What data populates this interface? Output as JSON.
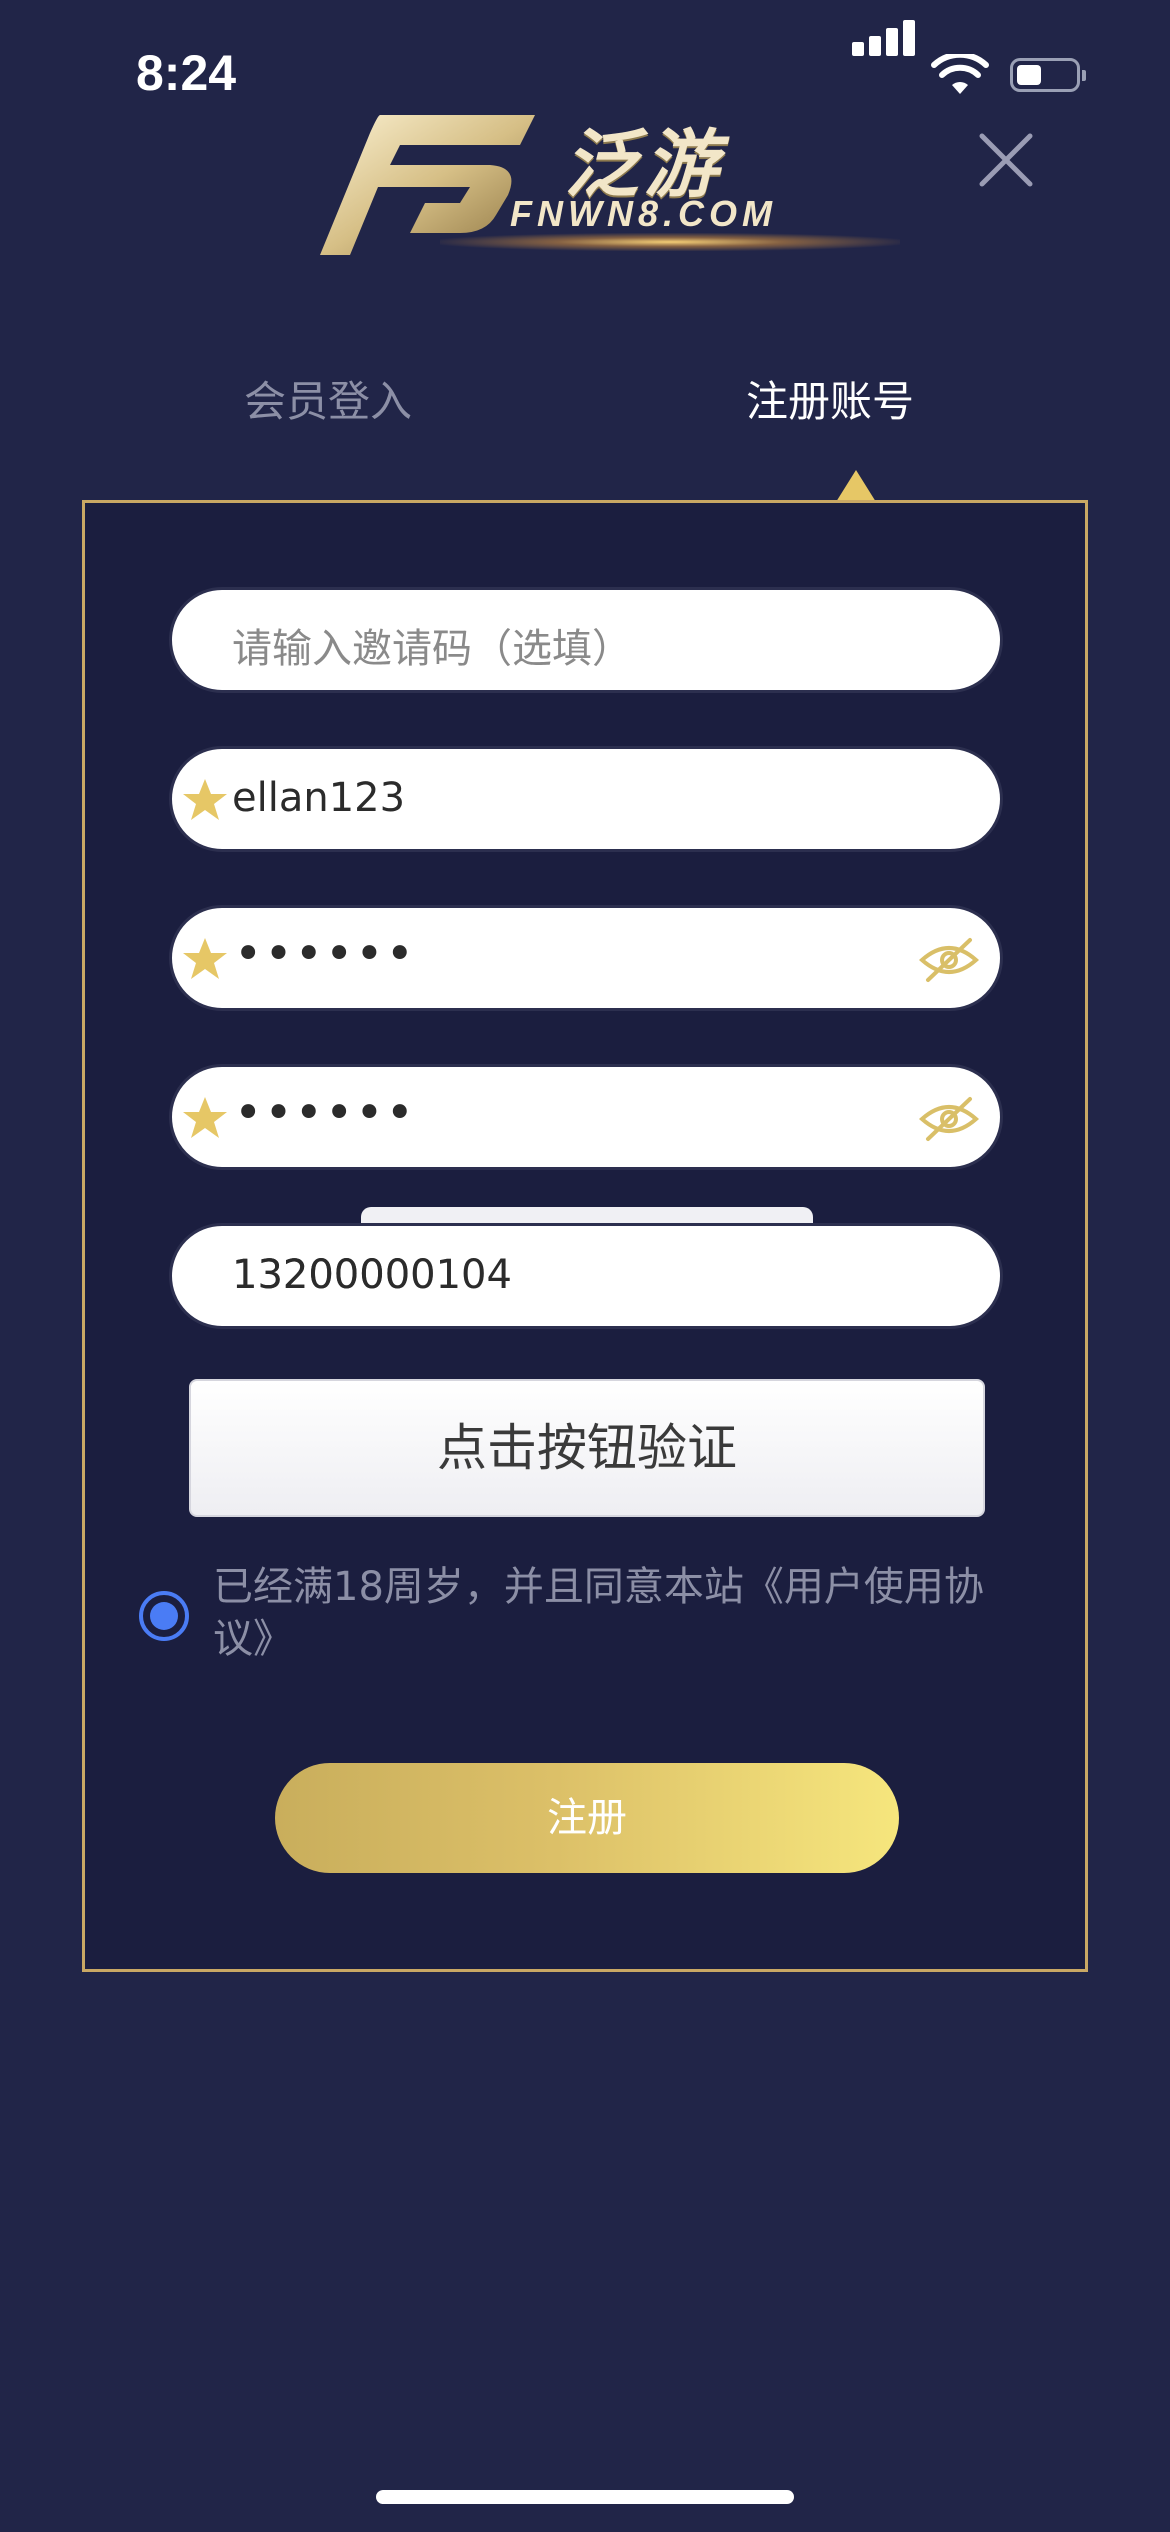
{
  "status_bar": {
    "time": "8:24"
  },
  "logo": {
    "brand_cn": "泛游",
    "brand_en": "FNWN8.COM"
  },
  "tabs": [
    {
      "label": "会员登入",
      "active": false
    },
    {
      "label": "注册账号",
      "active": true
    }
  ],
  "form": {
    "invite_code": {
      "value": "",
      "placeholder": "请输入邀请码（选填）"
    },
    "username": {
      "value": "ellan123"
    },
    "password": {
      "value": "••••••"
    },
    "confirm_password": {
      "value": "••••••"
    },
    "phone": {
      "value": "13200000104"
    },
    "verify_button_label": "点击按钮验证",
    "agreement_text": "已经满18周岁，并且同意本站《用户使用协议》",
    "agreement_checked": true,
    "submit_label": "注册"
  },
  "colors": {
    "background": "#212548",
    "panel": "#1b1e3f",
    "panel_border": "#c9a864",
    "gold": "#e6c766",
    "radio_blue": "#4a7cf5"
  }
}
